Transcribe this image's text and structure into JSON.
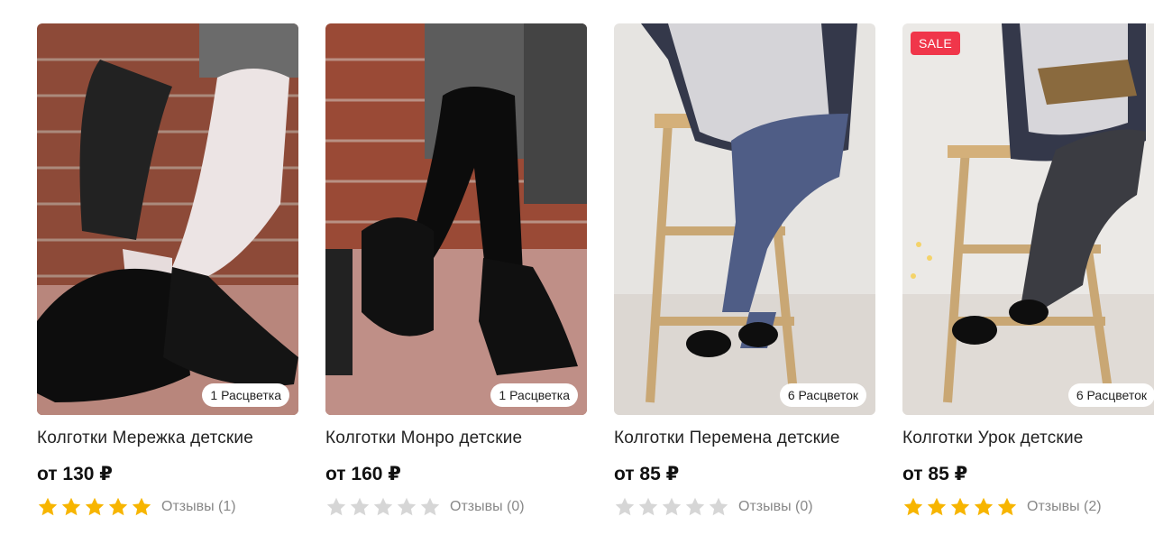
{
  "products": [
    {
      "title": "Колготки Мережка детские",
      "price": "от 130 ₽",
      "colors_badge": "1 Расцветка",
      "sale_badge": "",
      "rating": 5,
      "reviews": "Отзывы (1)",
      "image": "kids-tights-white-lace-boots"
    },
    {
      "title": "Колготки Монро детские",
      "price": "от 160 ₽",
      "colors_badge": "1 Расцветка",
      "sale_badge": "",
      "rating": 0,
      "reviews": "Отзывы (0)",
      "image": "kids-tights-black-pattern-boots"
    },
    {
      "title": "Колготки Перемена детские",
      "price": "от 85 ₽",
      "colors_badge": "6 Расцветок",
      "sale_badge": "",
      "rating": 0,
      "reviews": "Отзывы (0)",
      "image": "kids-tights-blue-on-stool"
    },
    {
      "title": "Колготки Урок детские",
      "price": "от 85 ₽",
      "colors_badge": "6 Расцветок",
      "sale_badge": "SALE",
      "rating": 5,
      "reviews": "Отзывы (2)",
      "image": "kids-tights-grey-on-stool"
    }
  ],
  "colors": {
    "star_filled": "#f7b500",
    "star_empty": "#d6d6d6",
    "sale": "#f0364a"
  }
}
